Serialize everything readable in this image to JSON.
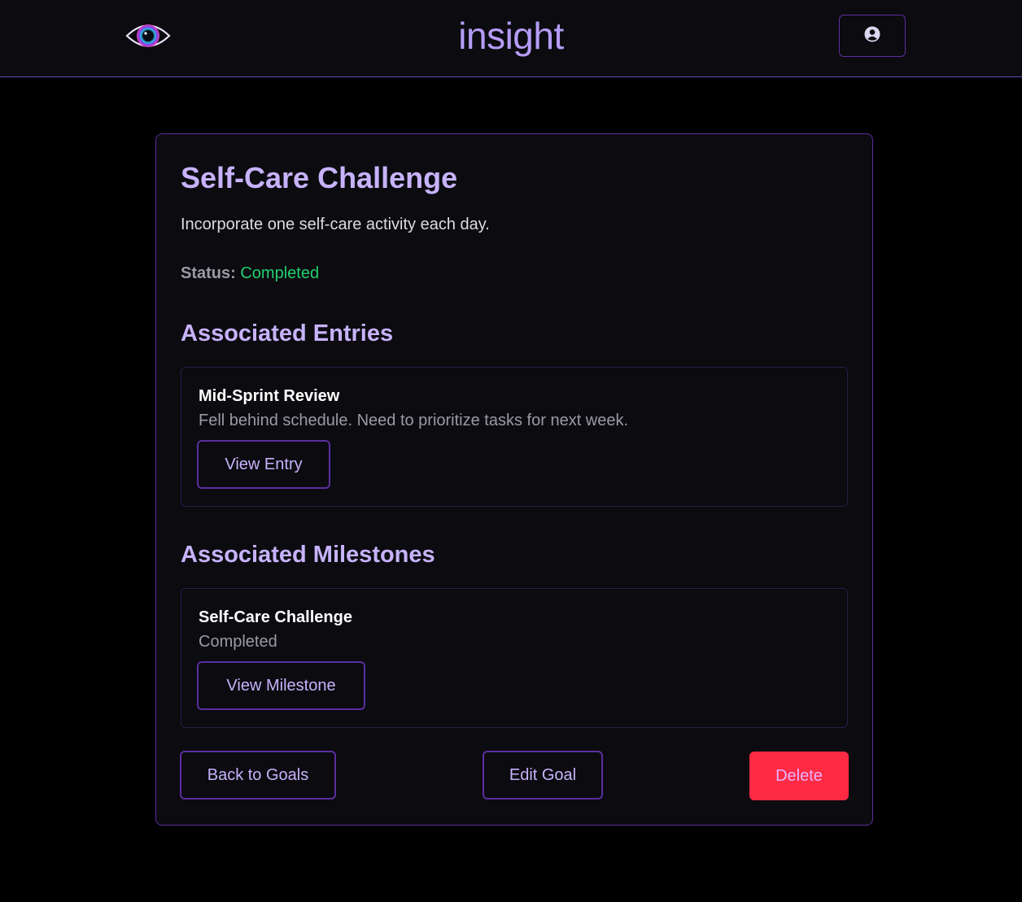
{
  "header": {
    "brand": "insight"
  },
  "goal": {
    "title": "Self-Care Challenge",
    "description": "Incorporate one self-care activity each day.",
    "status_label": "Status:",
    "status_value": "Completed"
  },
  "entries": {
    "heading": "Associated Entries",
    "items": [
      {
        "title": "Mid-Sprint Review",
        "summary": "Fell behind schedule. Need to prioritize tasks for next week.",
        "button": "View Entry"
      }
    ]
  },
  "milestones": {
    "heading": "Associated Milestones",
    "items": [
      {
        "title": "Self-Care Challenge",
        "status": "Completed",
        "button": "View Milestone"
      }
    ]
  },
  "actions": {
    "back": "Back to Goals",
    "edit": "Edit Goal",
    "delete": "Delete"
  },
  "colors": {
    "accent": "#c7b2fb",
    "border": "#5b2e9e",
    "status_success": "#22d06e",
    "danger": "#ff2a44"
  },
  "icons": {
    "logo": "eye-logo-icon",
    "profile": "user-circle-icon"
  }
}
